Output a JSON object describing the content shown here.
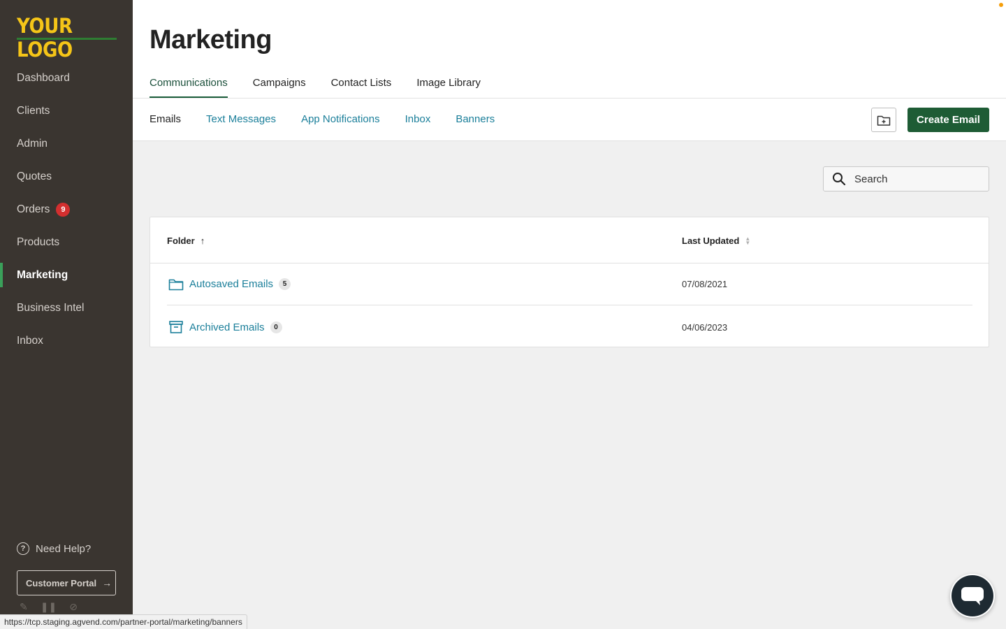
{
  "sidebar": {
    "logo": "YOUR LOGO",
    "nav": [
      {
        "label": "Dashboard"
      },
      {
        "label": "Clients"
      },
      {
        "label": "Admin"
      },
      {
        "label": "Quotes"
      },
      {
        "label": "Orders",
        "badge": "9"
      },
      {
        "label": "Products"
      },
      {
        "label": "Marketing",
        "active": true
      },
      {
        "label": "Business Intel"
      },
      {
        "label": "Inbox"
      }
    ],
    "help_label": "Need Help?",
    "portal_label": "Customer Portal"
  },
  "header": {
    "title": "Marketing",
    "main_tabs": [
      "Communications",
      "Campaigns",
      "Contact Lists",
      "Image Library"
    ],
    "active_main_tab": "Communications",
    "sub_tabs": [
      "Emails",
      "Text Messages",
      "App Notifications",
      "Inbox",
      "Banners"
    ],
    "active_sub_tab": "Emails",
    "create_label": "Create Email"
  },
  "search": {
    "placeholder": "Search"
  },
  "table": {
    "columns": {
      "folder": "Folder",
      "updated": "Last Updated"
    },
    "rows": [
      {
        "name": "Autosaved Emails",
        "count": "5",
        "date": "07/08/2021",
        "icon": "folder-icon"
      },
      {
        "name": "Archived Emails",
        "count": "0",
        "date": "04/06/2023",
        "icon": "archive-icon"
      }
    ]
  },
  "status_url": "https://tcp.staging.agvend.com/partner-portal/marketing/banners",
  "colors": {
    "sidebar": "#3a3530",
    "logo": "#f5c518",
    "primary": "#1e5c35",
    "link": "#1b7f9a",
    "badge": "#d32f2f"
  }
}
